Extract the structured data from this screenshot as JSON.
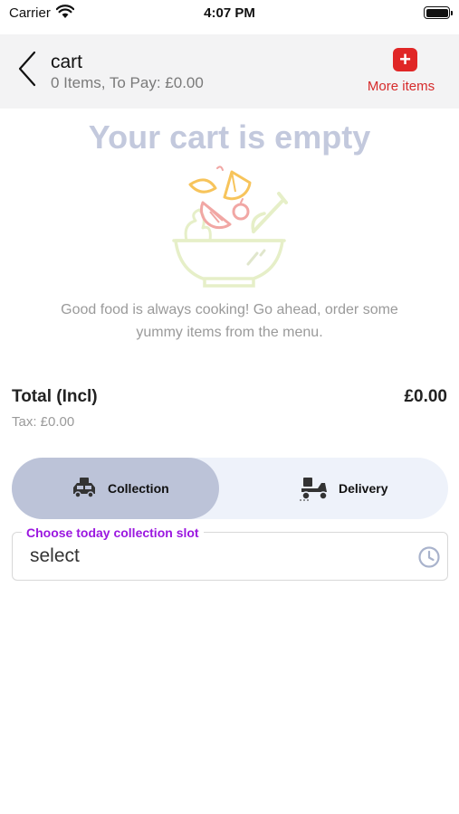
{
  "status_bar": {
    "carrier": "Carrier",
    "time": "4:07 PM"
  },
  "header": {
    "title": "cart",
    "subtitle": "0 Items, To Pay: £0.00",
    "more_label": "More items",
    "more_icon": "+",
    "accent": "#e02626"
  },
  "empty_state": {
    "title": "Your cart is empty",
    "message": "Good food is always cooking! Go ahead, order some yummy items from the menu."
  },
  "totals": {
    "label": "Total (Incl)",
    "value": "£0.00",
    "tax": "Tax: £0.00"
  },
  "order_mode": {
    "selected": "collection",
    "options": [
      {
        "id": "collection",
        "label": "Collection",
        "icon": "takeaway-icon"
      },
      {
        "id": "delivery",
        "label": "Delivery",
        "icon": "scooter-icon"
      }
    ]
  },
  "slot": {
    "legend": "Choose today collection slot",
    "value": "select",
    "icon": "clock-icon",
    "legend_color": "#9b17e0"
  }
}
